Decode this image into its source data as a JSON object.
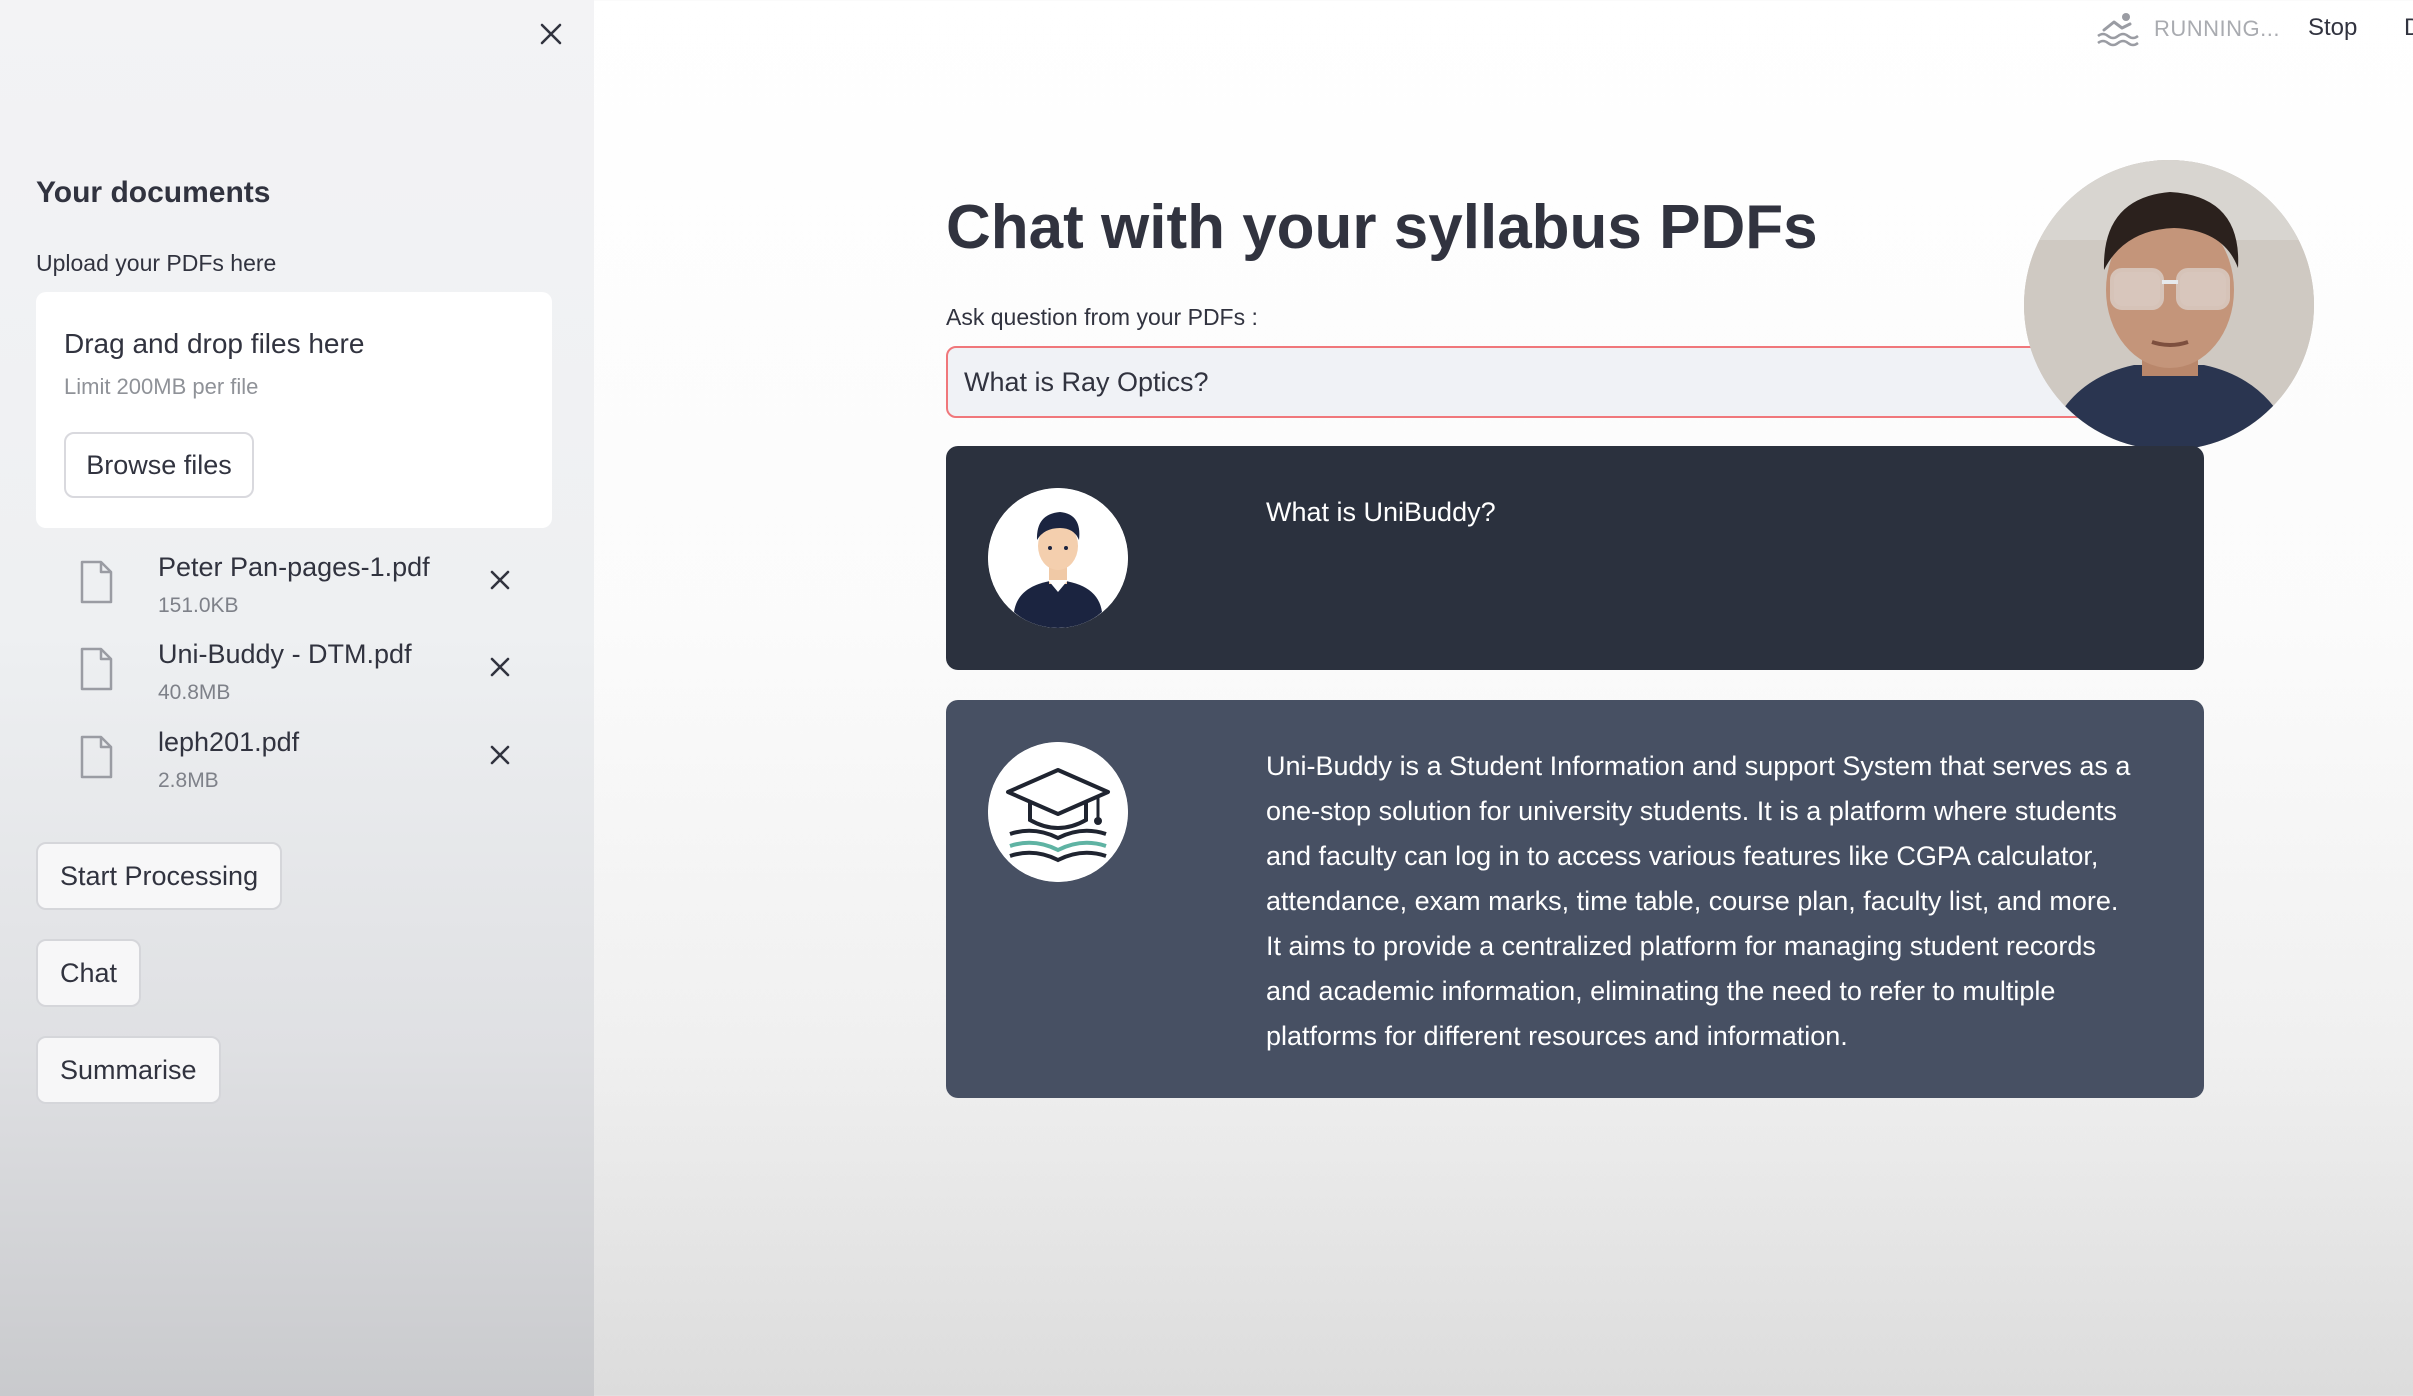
{
  "sidebar": {
    "close_icon": "close-icon",
    "heading": "Your documents",
    "upload_label": "Upload your PDFs here",
    "dropzone": {
      "title": "Drag and drop files here",
      "limit": "Limit 200MB per file",
      "browse_label": "Browse files"
    },
    "files": [
      {
        "name": "Peter Pan-pages-1.pdf",
        "size": "151.0KB"
      },
      {
        "name": "Uni-Buddy - DTM.pdf",
        "size": "40.8MB"
      },
      {
        "name": "leph201.pdf",
        "size": "2.8MB"
      }
    ],
    "buttons": {
      "start_processing": "Start Processing",
      "chat": "Chat",
      "summarise": "Summarise"
    }
  },
  "toolbar": {
    "status": "RUNNING...",
    "stop_label": "Stop",
    "deploy_label": "D"
  },
  "main": {
    "title": "Chat with your syllabus PDFs",
    "input_label": "Ask question from your PDFs :",
    "input_value": "What is Ray Optics?",
    "messages": [
      {
        "role": "user",
        "avatar": "user-avatar",
        "text": "What is UniBuddy?"
      },
      {
        "role": "bot",
        "avatar": "graduation-cap-book-avatar",
        "text": "Uni-Buddy is a Student Information and support System that serves as a one-stop solution for university students. It is a platform where students and faculty can log in to access various features like CGPA calculator, attendance, exam marks, time table, course plan, faculty list, and more. It aims to provide a centralized platform for managing student records and academic information, eliminating the need to refer to multiple platforms for different resources and information."
      }
    ]
  },
  "colors": {
    "user_message_bg": "#2b313e",
    "bot_message_bg": "#475063",
    "input_focus_border": "#f0777b",
    "sidebar_bg": "#f0f2f6"
  }
}
